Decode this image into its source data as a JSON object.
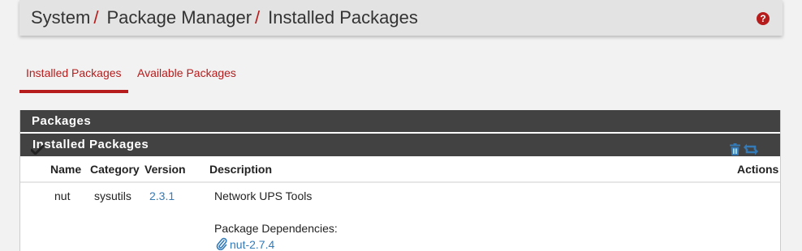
{
  "breadcrumb": {
    "items": [
      "System",
      "Package Manager",
      "Installed Packages"
    ],
    "separator": "/"
  },
  "help_icon": "question-circle-icon",
  "tabs": [
    {
      "label": "Installed Packages",
      "active": true
    },
    {
      "label": "Available Packages",
      "active": false
    }
  ],
  "panel": {
    "title": "Packages",
    "subtitle": "Installed Packages",
    "columns": {
      "name": "Name",
      "category": "Category",
      "version": "Version",
      "description": "Description",
      "actions": "Actions"
    },
    "rows": [
      {
        "status_icon": "checkmark-icon",
        "name": "nut",
        "category": "sysutils",
        "version": "2.3.1",
        "description": "Network UPS Tools",
        "dependencies_label": "Package Dependencies:",
        "dependency": "nut-2.7.4",
        "actions": [
          "trash-icon",
          "reinstall-icon"
        ]
      }
    ]
  },
  "colors": {
    "accent": "#b71c1c",
    "panel_header": "#424242",
    "link": "#337ab7",
    "background": "#f2f2f2",
    "breadcrumb_bar": "#e3e3e3"
  }
}
